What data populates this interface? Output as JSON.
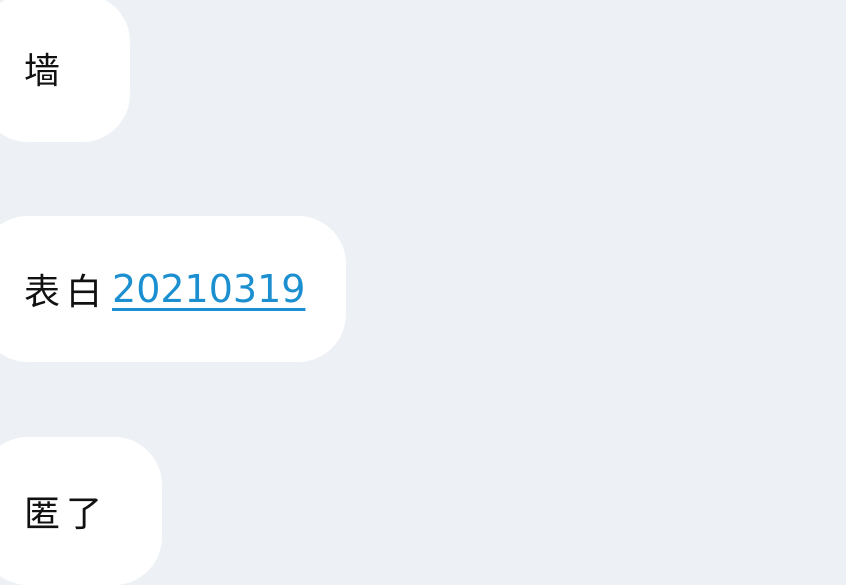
{
  "background_color": "#edf1f6",
  "bubble_color": "#ffffff",
  "link_color": "#1b8fd0",
  "messages": [
    {
      "text": "墙"
    },
    {
      "text": "表白",
      "link": "20210319"
    },
    {
      "text": "匿了"
    }
  ]
}
